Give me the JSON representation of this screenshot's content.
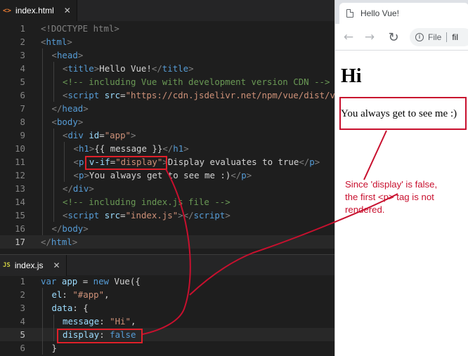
{
  "editor": {
    "html_tab": {
      "icon": "<>",
      "label": "index.html",
      "close": "✕"
    },
    "js_tab": {
      "icon": "JS",
      "label": "index.js",
      "close": "✕"
    },
    "html_lines": [
      {
        "n": "1",
        "tokens": [
          [
            "t-doctype",
            "<!DOCTYPE html>"
          ]
        ]
      },
      {
        "n": "2",
        "tokens": [
          [
            "t-punct",
            "<"
          ],
          [
            "t-tag",
            "html"
          ],
          [
            "t-punct",
            ">"
          ]
        ]
      },
      {
        "n": "3",
        "tokens": [
          [
            "t-punct",
            "<"
          ],
          [
            "t-tag",
            "head"
          ],
          [
            "t-punct",
            ">"
          ]
        ]
      },
      {
        "n": "4",
        "tokens": [
          [
            "t-punct",
            "<"
          ],
          [
            "t-tag",
            "title"
          ],
          [
            "t-punct",
            ">"
          ],
          [
            "t-txt",
            "Hello Vue!"
          ],
          [
            "t-punct",
            "</"
          ],
          [
            "t-tag",
            "title"
          ],
          [
            "t-punct",
            ">"
          ]
        ]
      },
      {
        "n": "5",
        "tokens": [
          [
            "t-com",
            "<!-- including Vue with development version CDN -->"
          ]
        ]
      },
      {
        "n": "6",
        "tokens": [
          [
            "t-punct",
            "<"
          ],
          [
            "t-tag",
            "script"
          ],
          [
            "t-txt",
            " "
          ],
          [
            "t-attr",
            "src"
          ],
          [
            "t-txt",
            "="
          ],
          [
            "t-str",
            "\"https://cdn.jsdelivr.net/npm/vue/dist/vue.js\""
          ],
          [
            "t-punct",
            "></"
          ],
          [
            "t-tag",
            "script"
          ],
          [
            "t-punct",
            ">"
          ]
        ]
      },
      {
        "n": "7",
        "tokens": [
          [
            "t-punct",
            "</"
          ],
          [
            "t-tag",
            "head"
          ],
          [
            "t-punct",
            ">"
          ]
        ]
      },
      {
        "n": "8",
        "tokens": [
          [
            "t-punct",
            "<"
          ],
          [
            "t-tag",
            "body"
          ],
          [
            "t-punct",
            ">"
          ]
        ]
      },
      {
        "n": "9",
        "tokens": [
          [
            "t-punct",
            "<"
          ],
          [
            "t-tag",
            "div"
          ],
          [
            "t-txt",
            " "
          ],
          [
            "t-attr",
            "id"
          ],
          [
            "t-txt",
            "="
          ],
          [
            "t-str",
            "\"app\""
          ],
          [
            "t-punct",
            ">"
          ]
        ]
      },
      {
        "n": "10",
        "tokens": [
          [
            "t-punct",
            "<"
          ],
          [
            "t-tag",
            "h1"
          ],
          [
            "t-punct",
            ">"
          ],
          [
            "t-txt",
            "{{ message }}"
          ],
          [
            "t-punct",
            "</"
          ],
          [
            "t-tag",
            "h1"
          ],
          [
            "t-punct",
            ">"
          ]
        ]
      },
      {
        "n": "11",
        "tokens": [
          [
            "t-punct",
            "<"
          ],
          [
            "t-tag",
            "p"
          ],
          [
            "t-txt",
            " "
          ],
          [
            "t-attr",
            "v-if"
          ],
          [
            "t-txt",
            "="
          ],
          [
            "t-str",
            "\"display\""
          ],
          [
            "t-punct",
            ">"
          ],
          [
            "t-txt",
            "Display evaluates to true"
          ],
          [
            "t-punct",
            "</"
          ],
          [
            "t-tag",
            "p"
          ],
          [
            "t-punct",
            ">"
          ]
        ]
      },
      {
        "n": "12",
        "tokens": [
          [
            "t-punct",
            "<"
          ],
          [
            "t-tag",
            "p"
          ],
          [
            "t-punct",
            ">"
          ],
          [
            "t-txt",
            "You always get to see me :)"
          ],
          [
            "t-punct",
            "</"
          ],
          [
            "t-tag",
            "p"
          ],
          [
            "t-punct",
            ">"
          ]
        ]
      },
      {
        "n": "13",
        "tokens": [
          [
            "t-punct",
            "</"
          ],
          [
            "t-tag",
            "div"
          ],
          [
            "t-punct",
            ">"
          ]
        ]
      },
      {
        "n": "14",
        "tokens": [
          [
            "t-com",
            "<!-- including index.js file -->"
          ]
        ]
      },
      {
        "n": "15",
        "tokens": [
          [
            "t-punct",
            "<"
          ],
          [
            "t-tag",
            "script"
          ],
          [
            "t-txt",
            " "
          ],
          [
            "t-attr",
            "src"
          ],
          [
            "t-txt",
            "="
          ],
          [
            "t-str",
            "\"index.js\""
          ],
          [
            "t-punct",
            "></"
          ],
          [
            "t-tag",
            "script"
          ],
          [
            "t-punct",
            ">"
          ]
        ]
      },
      {
        "n": "16",
        "tokens": [
          [
            "t-punct",
            "</"
          ],
          [
            "t-tag",
            "body"
          ],
          [
            "t-punct",
            ">"
          ]
        ]
      },
      {
        "n": "17",
        "tokens": [
          [
            "t-punct",
            "</"
          ],
          [
            "t-tag",
            "html"
          ],
          [
            "t-punct",
            ">"
          ]
        ]
      }
    ],
    "js_lines": [
      {
        "n": "1",
        "tokens": [
          [
            "t-kw",
            "var"
          ],
          [
            "t-txt",
            " "
          ],
          [
            "t-prop",
            "app"
          ],
          [
            "t-txt",
            " = "
          ],
          [
            "t-kw",
            "new"
          ],
          [
            "t-txt",
            " Vue({"
          ]
        ]
      },
      {
        "n": "2",
        "tokens": [
          [
            "t-prop",
            "el"
          ],
          [
            "t-txt",
            ": "
          ],
          [
            "t-str",
            "\"#app\""
          ],
          [
            "t-txt",
            ","
          ]
        ]
      },
      {
        "n": "3",
        "tokens": [
          [
            "t-prop",
            "data"
          ],
          [
            "t-txt",
            ": {"
          ]
        ]
      },
      {
        "n": "4",
        "tokens": [
          [
            "t-prop",
            "message"
          ],
          [
            "t-txt",
            ": "
          ],
          [
            "t-str",
            "\"Hi\""
          ],
          [
            "t-txt",
            ","
          ]
        ]
      },
      {
        "n": "5",
        "tokens": [
          [
            "t-prop",
            "display"
          ],
          [
            "t-txt",
            ": "
          ],
          [
            "t-kw",
            "false"
          ]
        ]
      },
      {
        "n": "6",
        "tokens": [
          [
            "t-txt",
            "}"
          ]
        ]
      }
    ]
  },
  "browser": {
    "tab_title": "Hello Vue!",
    "back_icon": "←",
    "forward_icon": "→",
    "reload_icon": "↻",
    "info_icon": "i",
    "omnibox_scheme": "File",
    "omnibox_url": "fil",
    "page": {
      "heading": "Hi",
      "paragraph": "You always get to see me :)"
    }
  },
  "annotation": {
    "lines": [
      "Since 'display' is false,",
      "the first <p> tag is not",
      "rendered."
    ]
  },
  "colors": {
    "accent_red": "#c8102e",
    "editor_bg": "#1e1e1e"
  }
}
